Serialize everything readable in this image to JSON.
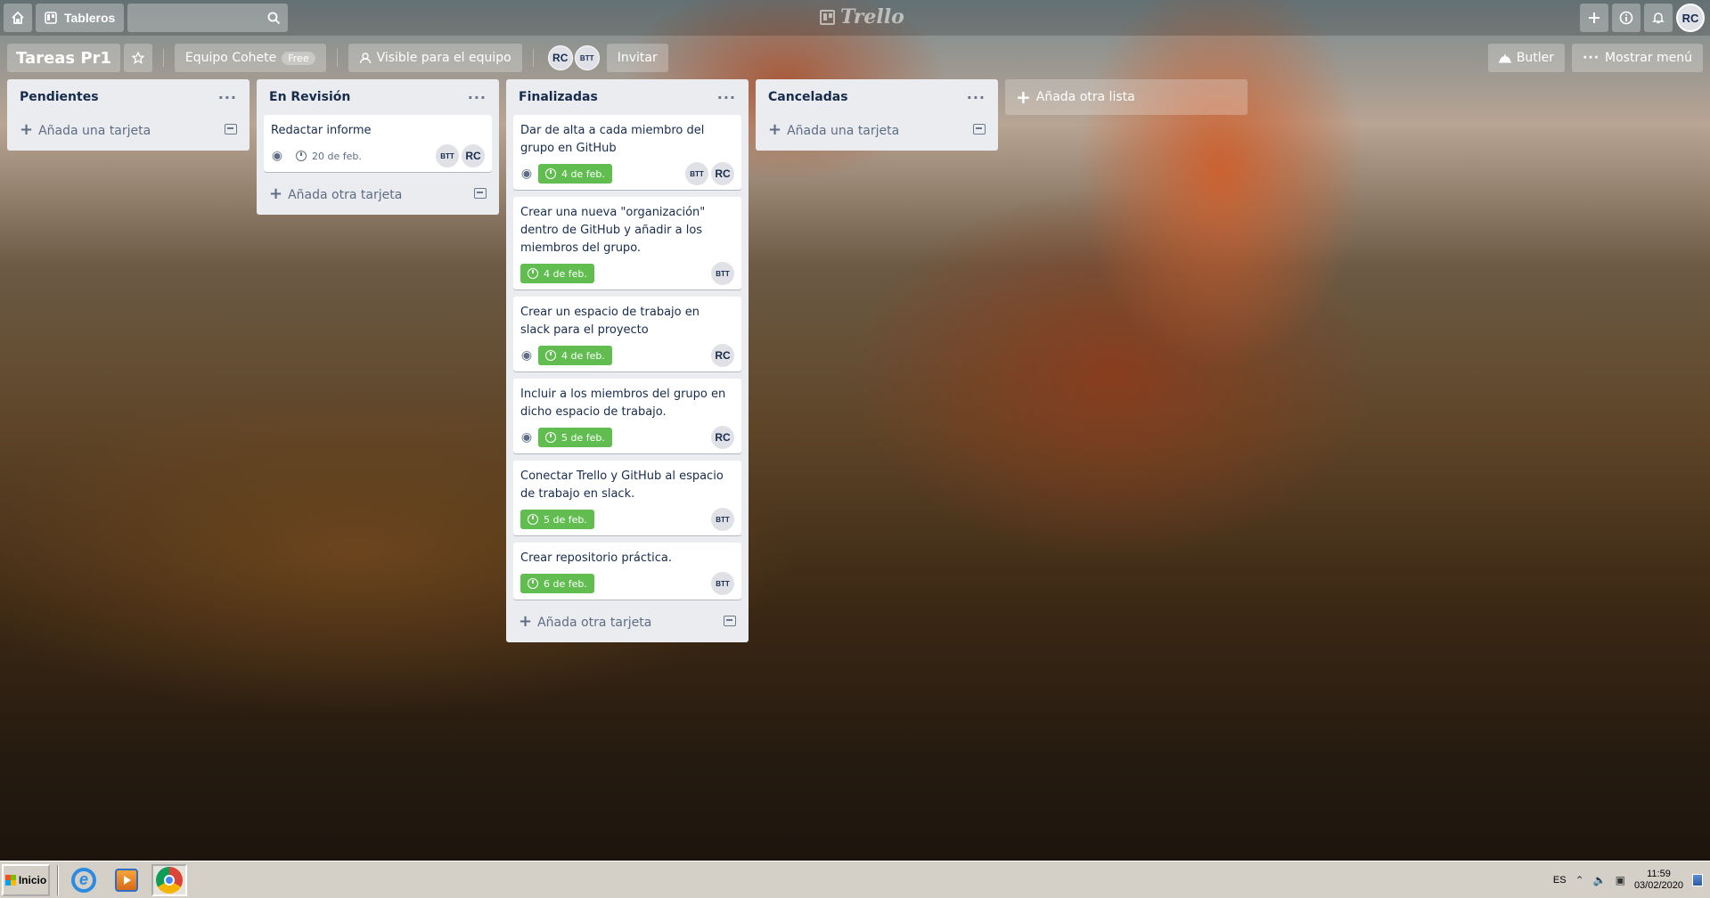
{
  "header": {
    "boards_label": "Tableros",
    "search_placeholder": "",
    "logo_text": "Trello",
    "user_initials": "RC"
  },
  "board": {
    "title": "Tareas Pr1",
    "team_label": "Equipo Cohete",
    "team_badge": "Free",
    "visibility_label": "Visible para el equipo",
    "members": [
      "RC",
      "BTT"
    ],
    "invite_label": "Invitar",
    "butler_label": "Butler",
    "menu_label": "Mostrar menú"
  },
  "lists": [
    {
      "title": "Pendientes",
      "cards": [],
      "add_card_label": "Añada una tarjeta"
    },
    {
      "title": "En Revisión",
      "cards": [
        {
          "title": "Redactar informe",
          "due": "20 de feb.",
          "members": [
            "BTT",
            "RC"
          ]
        }
      ],
      "add_card_label": "Añada otra tarjeta"
    },
    {
      "title": "Finalizadas",
      "cards": [
        {
          "title": "Dar de alta a cada miembro del grupo en GitHub",
          "due": "4 de feb.",
          "members": [
            "BTT",
            "RC"
          ]
        },
        {
          "title": "Crear una nueva \"organización\" dentro de GitHub y añadir a los miembros del grupo.",
          "due": "4 de feb.",
          "members": [
            "BTT"
          ]
        },
        {
          "title": "Crear un espacio de trabajo en slack para el proyecto",
          "due": "4 de feb.",
          "members": [
            "RC"
          ]
        },
        {
          "title": "Incluir a los miembros del grupo en dicho espacio de trabajo.",
          "due": "5 de feb.",
          "members": [
            "RC"
          ]
        },
        {
          "title": "Conectar Trello y GitHub al espacio de trabajo en slack.",
          "due": "5 de feb.",
          "members": [
            "BTT"
          ]
        },
        {
          "title": "Crear repositorio práctica.",
          "due": "6 de feb.",
          "members": [
            "BTT"
          ]
        }
      ],
      "add_card_label": "Añada otra tarjeta"
    },
    {
      "title": "Canceladas",
      "cards": [],
      "add_card_label": "Añada una tarjeta"
    }
  ],
  "add_list_label": "Añada otra lista",
  "taskbar": {
    "start_label": "Inicio",
    "language": "ES",
    "time": "11:59",
    "date": "03/02/2020"
  },
  "colors": {
    "due_complete": "#61bd4f",
    "list_bg": "#ebecf0"
  }
}
